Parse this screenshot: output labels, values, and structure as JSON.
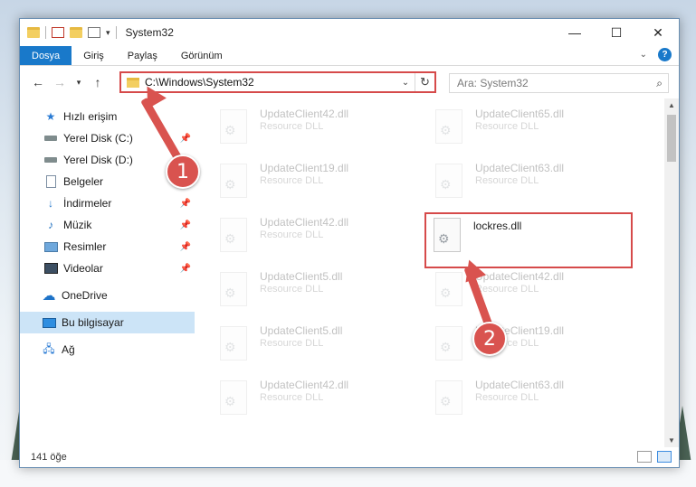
{
  "window": {
    "title": "System32",
    "controls": {
      "minimize": "—",
      "maximize": "☐",
      "close": "✕"
    }
  },
  "ribbon": {
    "tabs": [
      {
        "label": "Dosya",
        "active": true
      },
      {
        "label": "Giriş"
      },
      {
        "label": "Paylaş"
      },
      {
        "label": "Görünüm"
      }
    ],
    "help": "?"
  },
  "navigation": {
    "address_path": "C:\\Windows\\System32",
    "search_placeholder": "Ara: System32"
  },
  "sidebar": {
    "items": [
      {
        "label": "Hızlı erişim",
        "icon": "star-icon"
      },
      {
        "label": "Yerel Disk (C:)",
        "icon": "disk-icon",
        "pinned": true
      },
      {
        "label": "Yerel Disk (D:)",
        "icon": "disk-icon"
      },
      {
        "label": "Belgeler",
        "icon": "document-icon"
      },
      {
        "label": "İndirmeler",
        "icon": "download-icon",
        "pinned": true
      },
      {
        "label": "Müzik",
        "icon": "music-icon",
        "pinned": true
      },
      {
        "label": "Resimler",
        "icon": "pictures-icon",
        "pinned": true
      },
      {
        "label": "Videolar",
        "icon": "video-icon",
        "pinned": true
      },
      {
        "label": "OneDrive",
        "icon": "cloud-icon"
      },
      {
        "label": "Bu bilgisayar",
        "icon": "computer-icon",
        "selected": true
      },
      {
        "label": "Ağ",
        "icon": "network-icon"
      }
    ]
  },
  "files": [
    {
      "name": "UpdateClient42.dll",
      "type": "Resource DLL",
      "faded": true
    },
    {
      "name": "UpdateClient65.dll",
      "type": "Resource DLL",
      "faded": true
    },
    {
      "name": "UpdateClient19.dll",
      "type": "Resource DLL",
      "faded": true
    },
    {
      "name": "UpdateClient63.dll",
      "type": "Resource DLL",
      "faded": true
    },
    {
      "name": "UpdateClient42.dll",
      "type": "Resource DLL",
      "faded": true
    },
    {
      "name": "lockres.dll",
      "type": "",
      "highlighted": true
    },
    {
      "name": "UpdateClient5.dll",
      "type": "Resource DLL",
      "faded": true
    },
    {
      "name": "UpdateClient42.dll",
      "type": "Resource DLL",
      "faded": true
    },
    {
      "name": "UpdateClient5.dll",
      "type": "Resource DLL",
      "faded": true
    },
    {
      "name": "UpdateClient19.dll",
      "type": "Resource DLL",
      "faded": true
    },
    {
      "name": "UpdateClient42.dll",
      "type": "Resource DLL",
      "faded": true
    },
    {
      "name": "UpdateClient63.dll",
      "type": "Resource DLL",
      "faded": true
    }
  ],
  "status": {
    "item_count": "141 öğe"
  },
  "annotations": {
    "step1": "1",
    "step2": "2",
    "color": "#d9534f"
  }
}
